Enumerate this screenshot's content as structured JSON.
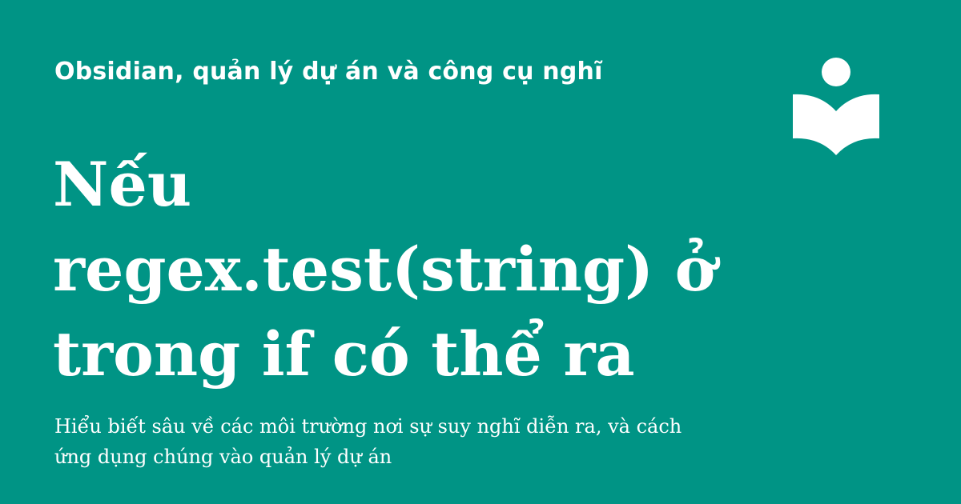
{
  "site_name": "Obsidian, quản lý dự án và công cụ nghĩ",
  "title": "Nếu regex.test(string) ở trong if có thể ra",
  "description": "Hiểu biết sâu về các môi trường nơi sự suy nghĩ diễn ra, và cách ứng dụng chúng vào quản lý dự án",
  "colors": {
    "background": "#009485",
    "foreground": "#ffffff"
  },
  "logo_icon": "reading-book-icon"
}
